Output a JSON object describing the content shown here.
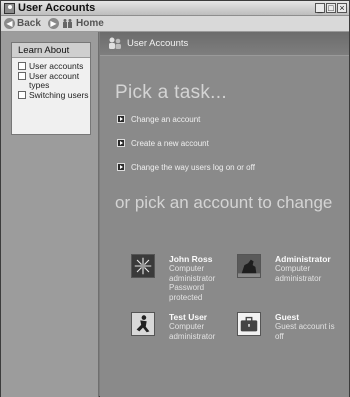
{
  "window": {
    "title": "User Accounts"
  },
  "toolbar": {
    "back_label": "Back",
    "home_label": "Home"
  },
  "sidebar": {
    "learn_about": {
      "heading": "Learn About",
      "items": [
        {
          "label": "User accounts"
        },
        {
          "label": "User account types"
        },
        {
          "label": "Switching users"
        }
      ]
    }
  },
  "main": {
    "header_title": "User Accounts",
    "pick_task_heading": "Pick a task...",
    "tasks": [
      {
        "label": "Change an account"
      },
      {
        "label": "Create a new account"
      },
      {
        "label": "Change the way users log on or off"
      }
    ],
    "pick_account_heading": "or pick an account to change",
    "accounts": [
      {
        "name": "John Ross",
        "description": "Computer administrator Password protected",
        "picture": "flower-picture"
      },
      {
        "name": "Administrator",
        "description": "Computer administrator",
        "picture": "horse-picture"
      },
      {
        "name": "Test User",
        "description": "Computer administrator",
        "picture": "skater-picture"
      },
      {
        "name": "Guest",
        "description": "Guest account is off",
        "picture": "briefcase-picture"
      }
    ]
  }
}
